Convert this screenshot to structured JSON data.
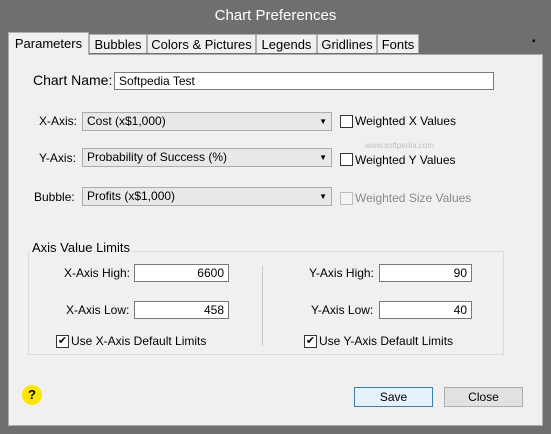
{
  "window": {
    "title": "Chart Preferences"
  },
  "tabs": [
    {
      "label": "Parameters"
    },
    {
      "label": "Bubbles"
    },
    {
      "label": "Colors & Pictures"
    },
    {
      "label": "Legends"
    },
    {
      "label": "Gridlines"
    },
    {
      "label": "Fonts"
    }
  ],
  "params": {
    "chart_name_label": "Chart Name:",
    "chart_name_value": "Softpedia Test",
    "x_axis_label": "X-Axis:",
    "x_axis_value": "Cost (x$1,000)",
    "y_axis_label": "Y-Axis:",
    "y_axis_value": "Probability of Success (%)",
    "bubble_label": "Bubble:",
    "bubble_value": "Profits (x$1,000)",
    "weighted_x_label": "Weighted X Values",
    "weighted_y_label": "Weighted Y Values",
    "weighted_size_label": "Weighted Size Values"
  },
  "limits": {
    "group_label": "Axis Value Limits",
    "x_high_label": "X-Axis High:",
    "x_high_value": "6600",
    "x_low_label": "X-Axis Low:",
    "x_low_value": "458",
    "x_default_label": "Use X-Axis Default Limits",
    "y_high_label": "Y-Axis High:",
    "y_high_value": "90",
    "y_low_label": "Y-Axis Low:",
    "y_low_value": "40",
    "y_default_label": "Use Y-Axis Default Limits"
  },
  "footer": {
    "help": "?",
    "save_label": "Save",
    "close_label": "Close"
  },
  "watermark": {
    "site": "www.softpedia.com"
  }
}
